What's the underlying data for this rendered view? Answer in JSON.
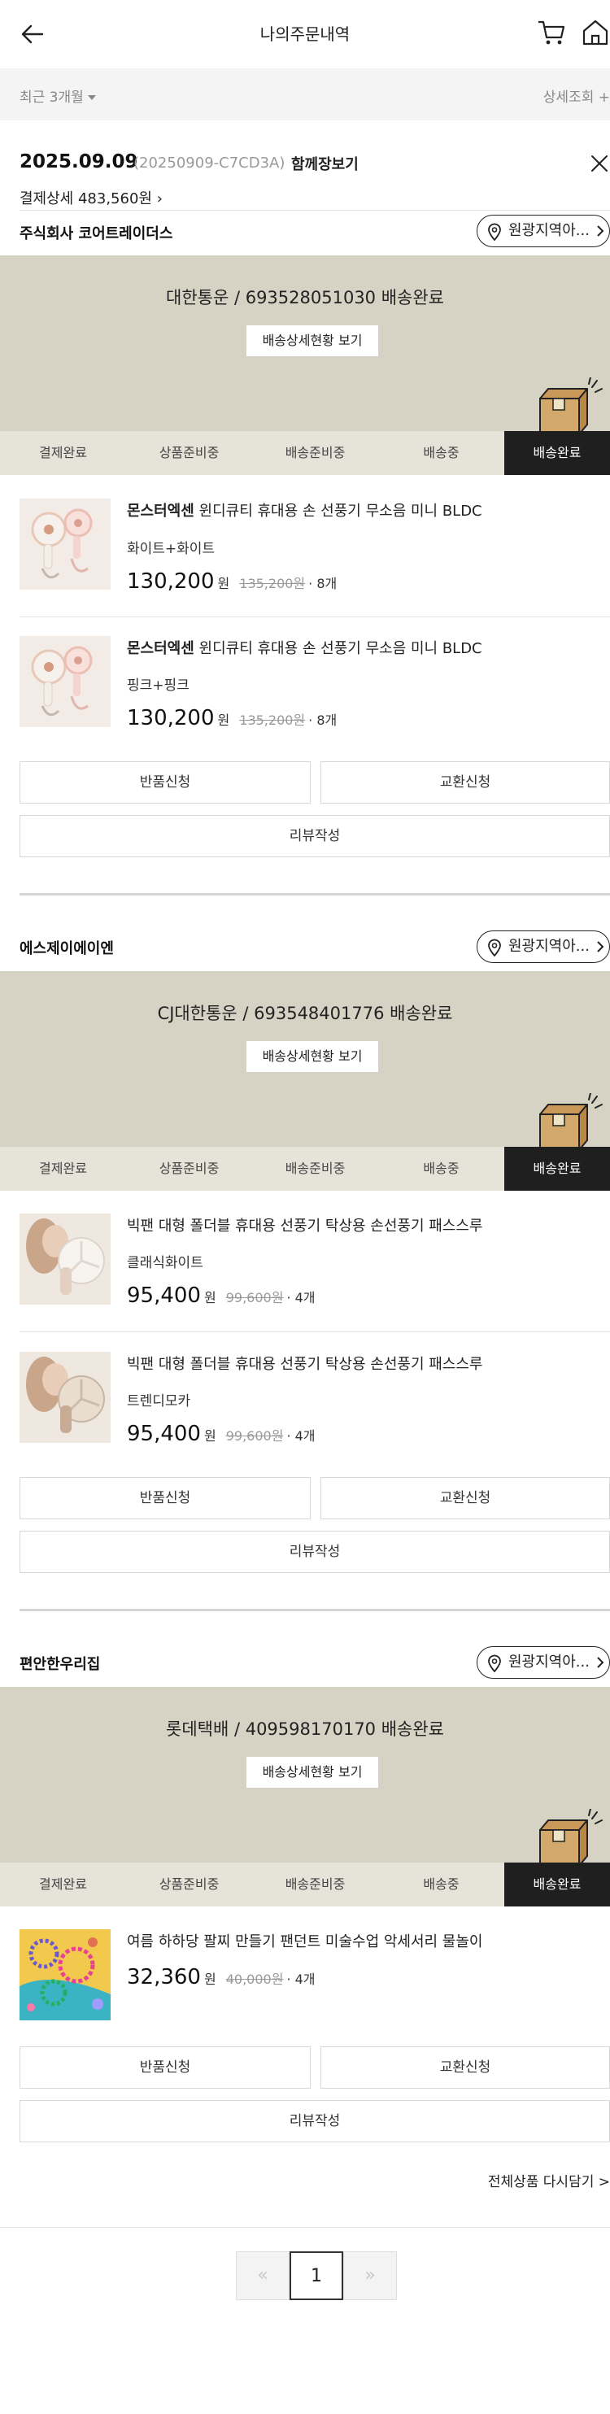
{
  "header": {
    "title": "나의주문내역"
  },
  "filter": {
    "period": "최근 3개월",
    "detail": "상세조회 +"
  },
  "order": {
    "date": "2025.09.09",
    "id": "(20250909-C7CD3A)",
    "view_cart": "함께장보기",
    "pay_detail": "결제상세 483,560원"
  },
  "steps": [
    "결제완료",
    "상품준비중",
    "배송준비중",
    "배송중",
    "배송완료"
  ],
  "labels": {
    "return": "반품신청",
    "exchange": "교환신청",
    "review": "리뷰작성",
    "track": "배송상세현황 보기",
    "region": "원광지역아..."
  },
  "sellers": [
    {
      "name": "주식회사 코어트레이더스",
      "carrier": "대한통운 / 693528051030 배송완료",
      "products": [
        {
          "brand": "몬스터엑센",
          "name": " 윈디큐티 휴대용 손 선풍기 무소음 미니 BLDC",
          "option": "화이트+화이트",
          "price": "130,200",
          "won": "원",
          "orig": "135,200원",
          "qty": "· 8개"
        },
        {
          "brand": "몬스터엑센",
          "name": " 윈디큐티 휴대용 손 선풍기 무소음 미니 BLDC",
          "option": "핑크+핑크",
          "price": "130,200",
          "won": "원",
          "orig": "135,200원",
          "qty": "· 8개"
        }
      ]
    },
    {
      "name": "에스제이에이엔",
      "carrier": "CJ대한통운 / 693548401776 배송완료",
      "products": [
        {
          "brand": "",
          "name": "빅팬 대형 폴더블 휴대용 선풍기 탁상용 손선풍기 패스스루",
          "option": "클래식화이트",
          "price": "95,400",
          "won": "원",
          "orig": "99,600원",
          "qty": "· 4개"
        },
        {
          "brand": "",
          "name": "빅팬 대형 폴더블 휴대용 선풍기 탁상용 손선풍기 패스스루",
          "option": "트렌디모카",
          "price": "95,400",
          "won": "원",
          "orig": "99,600원",
          "qty": "· 4개"
        }
      ]
    },
    {
      "name": "편안한우리집",
      "carrier": "롯데택배 / 409598170170 배송완료",
      "products": [
        {
          "brand": "",
          "name": "여름 하하당 팔찌 만들기 팬던트 미술수업 악세서리 물놀이",
          "option": "",
          "price": "32,360",
          "won": "원",
          "orig": "40,000원",
          "qty": "· 4개"
        }
      ]
    }
  ],
  "reorder_all": "전체상품 다시담기 >",
  "pagination": {
    "prev": "«",
    "current": "1",
    "next": "»"
  },
  "colors": {
    "banner": "#d7d3c4",
    "step_bar": "#e6e3d9",
    "active_step": "#1f1f1f",
    "box": "#d2a96a"
  }
}
